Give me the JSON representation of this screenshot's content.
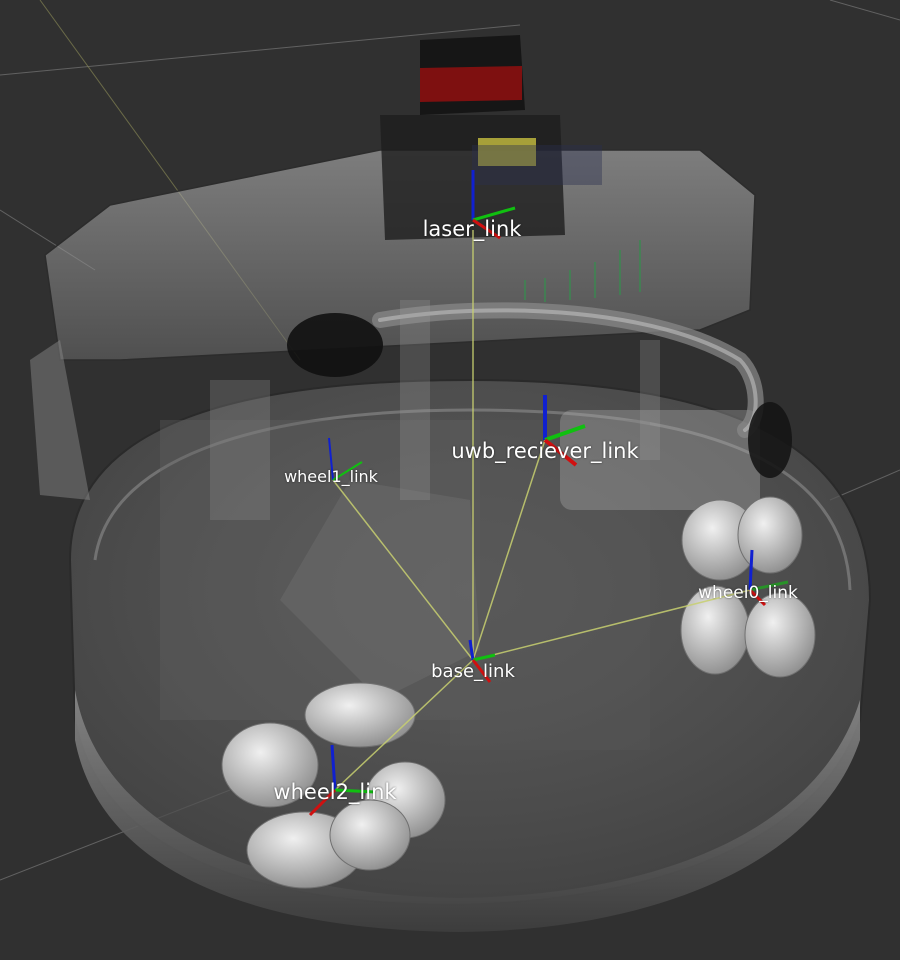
{
  "viewer": {
    "background_color": "#303030",
    "grid_color": "#a0a0a0",
    "axis_colors": {
      "x": "#d01010",
      "y": "#10c010",
      "z": "#1020d0"
    },
    "tf_link_color": "#c8d070"
  },
  "frames": [
    {
      "id": "laser",
      "label": "laser_link"
    },
    {
      "id": "uwb",
      "label": "uwb_reciever_link"
    },
    {
      "id": "wheel1",
      "label": "wheel1_link"
    },
    {
      "id": "wheel0",
      "label": "wheel0_link"
    },
    {
      "id": "base",
      "label": "base_link"
    },
    {
      "id": "wheel2",
      "label": "wheel2_link"
    }
  ]
}
